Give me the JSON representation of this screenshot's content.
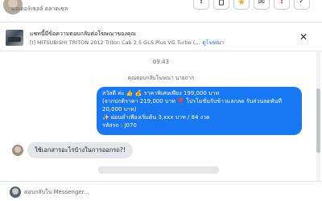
{
  "header": {
    "subtitle": "มอเตอร์เซลล์ ตลาดเซล",
    "buttons": [
      {
        "icon": "info-icon",
        "glyph": "!"
      },
      {
        "icon": "trash-icon",
        "glyph": "🗑"
      },
      {
        "icon": "star-icon",
        "glyph": "★",
        "color": "#f5a623"
      },
      {
        "icon": "mail-icon",
        "glyph": "✉"
      },
      {
        "icon": "report-icon",
        "glyph": "!",
        "color": "#e41e3f"
      },
      {
        "icon": "check-icon",
        "glyph": "✓"
      }
    ]
  },
  "banner": {
    "title": "แชทนี้มีข้อความตอบกลับต่อโฆษณาของคุณ",
    "listing": "[I] MITSUBISHI TRITON 2012 Triton Cab 2.5 GLS Plus VG Turbo (...",
    "link": "ดูโฆษณา",
    "close_glyph": "✕"
  },
  "chat": {
    "timestamp": "09:43",
    "sender_note": "คุณตอบกลับโฆษณา นายถาก",
    "outgoing_lines": [
      "สวัสดี ค่ะ 👍 💰 ราคาพิเศษเพียง 199,000 บาท",
      "(จากปกติราคา 219,000 บาท 🎈 โปรโมชั่นรับข้าวแลกลด รับส่วนลดทันที",
      "20,000 บาท)",
      "✨ ผ่อนต่ำเพียงเริ่มต้น 3,xxx บาท / 84 งวด",
      "รหัสรถ : J070"
    ],
    "incoming_text": "ใช้เอกสารอะไรบ้างในการออกรถ?!"
  },
  "composer": {
    "placeholder": "ตอบกลับใน Messenger..."
  },
  "colors": {
    "accent": "#1877f2",
    "incoming_bubble": "#e4e6eb",
    "star": "#f5a623",
    "report": "#e41e3f"
  }
}
